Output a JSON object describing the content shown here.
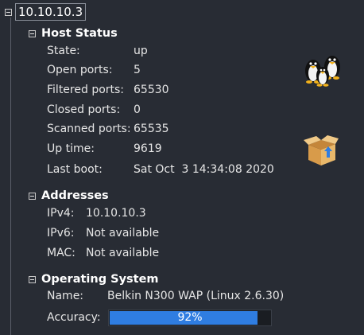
{
  "host": {
    "address": "10.10.10.3"
  },
  "host_status": {
    "title": "Host Status",
    "rows": [
      {
        "label": "State:",
        "value": "up"
      },
      {
        "label": "Open ports:",
        "value": "5"
      },
      {
        "label": "Filtered ports:",
        "value": "65530"
      },
      {
        "label": "Closed ports:",
        "value": "0"
      },
      {
        "label": "Scanned ports:",
        "value": "65535"
      },
      {
        "label": "Up time:",
        "value": "9619"
      },
      {
        "label": "Last boot:",
        "value": "Sat Oct  3 14:34:08 2020"
      }
    ]
  },
  "addresses": {
    "title": "Addresses",
    "rows": [
      {
        "label": "IPv4:",
        "value": "10.10.10.3"
      },
      {
        "label": "IPv6:",
        "value": "Not available"
      },
      {
        "label": "MAC:",
        "value": "Not available"
      }
    ]
  },
  "os": {
    "title": "Operating System",
    "name_label": "Name:",
    "name_value": "Belkin N300 WAP (Linux 2.6.30)",
    "accuracy_label": "Accuracy:",
    "accuracy_text": "92%",
    "accuracy_fraction": 0.92
  },
  "icons": {
    "os_icon": "linux-penguins-icon",
    "upgrade_icon": "open-box-icon"
  },
  "colors": {
    "background": "#282c34",
    "accuracy_fill": "#2f7de1"
  }
}
